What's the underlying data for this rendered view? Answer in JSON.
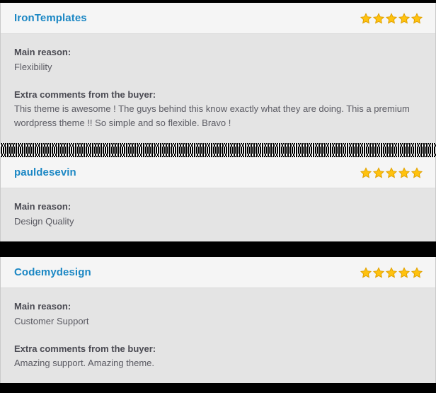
{
  "labels": {
    "main_reason": "Main reason:",
    "extra_comments": "Extra comments from the buyer:"
  },
  "colors": {
    "reviewer_link": "#1b87c4",
    "star_fill": "#ffc20e",
    "star_outline": "#e0a100",
    "card_header_bg": "#f5f5f5",
    "card_body_bg": "#e4e4e4",
    "label_text": "#4a4a52",
    "value_text": "#5b5b63",
    "divider": "#000000"
  },
  "icons": {
    "star": "star-icon"
  },
  "reviews": [
    {
      "reviewer": "IronTemplates",
      "rating": 5,
      "rating_max": 5,
      "main_reason": "Flexibility",
      "extra_comments": "This theme is awesome ! The guys behind this know exactly what they are doing. This a premium wordpress theme !! So simple and so flexible. Bravo !",
      "has_extra_comments": true
    },
    {
      "reviewer": "pauldesevin",
      "rating": 5,
      "rating_max": 5,
      "main_reason": "Design Quality",
      "extra_comments": "",
      "has_extra_comments": false
    },
    {
      "reviewer": "Codemydesign",
      "rating": 5,
      "rating_max": 5,
      "main_reason": "Customer Support",
      "extra_comments": "Amazing support. Amazing theme.",
      "has_extra_comments": true
    }
  ]
}
